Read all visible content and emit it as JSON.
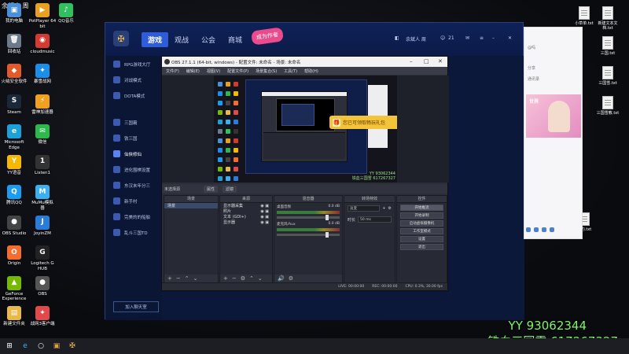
{
  "desktop": {
    "user_tag": "余额人 周",
    "icons": [
      {
        "label": "我的电脑",
        "glyph": "▣",
        "color": "#4a90d9"
      },
      {
        "label": "PotPlayer 64\nbit",
        "glyph": "▶",
        "color": "#e8a020"
      },
      {
        "label": "QQ音乐",
        "glyph": "♪",
        "color": "#30c060"
      },
      {
        "label": "回收站",
        "glyph": "🗑",
        "color": "#6c7a89"
      },
      {
        "label": "cloudmusic",
        "glyph": "◉",
        "color": "#d33a31"
      },
      {
        "label": "火绒安全软件",
        "glyph": "◆",
        "color": "#e05a2a"
      },
      {
        "label": "暴雪战网",
        "glyph": "✦",
        "color": "#1a8ee8"
      },
      {
        "label": "Steam",
        "glyph": "S",
        "color": "#1b2838"
      },
      {
        "label": "雷神加速器",
        "glyph": "⚡",
        "color": "#f0a020"
      },
      {
        "label": "Microsoft\nEdge",
        "glyph": "e",
        "color": "#1ba0d8"
      },
      {
        "label": "微信",
        "glyph": "✉",
        "color": "#2db84d"
      },
      {
        "label": "YY语音",
        "glyph": "Y",
        "color": "#f6b800"
      },
      {
        "label": "Listen1",
        "glyph": "1",
        "color": "#333"
      },
      {
        "label": "腾讯QQ",
        "glyph": "Q",
        "color": "#1a9cf0"
      },
      {
        "label": "MuMu模拟\n器",
        "glyph": "M",
        "color": "#3ab0f0"
      },
      {
        "label": "OBS Studio",
        "glyph": "●",
        "color": "#444"
      },
      {
        "label": "JoyinZM",
        "glyph": "J",
        "color": "#2b7bd8"
      },
      {
        "label": "Origin",
        "glyph": "O",
        "color": "#f56c2d"
      },
      {
        "label": "Logitech G\nHUB",
        "glyph": "G",
        "color": "#222"
      },
      {
        "label": "GeForce\nExperience",
        "glyph": "▲",
        "color": "#76b900"
      },
      {
        "label": "OBS",
        "glyph": "●",
        "color": "#555"
      },
      {
        "label": "新建文件夹",
        "glyph": "▤",
        "color": "#e8b84a"
      },
      {
        "label": "战网3客户端",
        "glyph": "✦",
        "color": "#e04a4a"
      }
    ],
    "files": [
      {
        "label": "小草单.txt"
      },
      {
        "label": "新建文本文\n档.txt"
      },
      {
        "label": "三国.txt"
      },
      {
        "label": "三国雪.txt"
      },
      {
        "label": "三国雪教.txt"
      },
      {
        "label": "我的.txt"
      }
    ]
  },
  "launcher": {
    "nav": [
      "游戏",
      "观战",
      "公会",
      "商城"
    ],
    "badge": "成为作者",
    "user": "余斌人 周",
    "count": "21",
    "side_items": [
      "RPG游戏大厅",
      "对战模式",
      "DOTA模式",
      "三国霸",
      "铁三国",
      "仙侠修仙",
      "进化围棋设置",
      "东汉末年分三",
      "新手村",
      "完美的的船舶",
      "乱斗三国TD"
    ],
    "join_button": "加入聊天室"
  },
  "chat": {
    "lines": [
      "@吗",
      "分享",
      "通讯录"
    ],
    "banner_text": "世界"
  },
  "obs": {
    "title": "OBS 27.1.1 (64-bit, windows) - 配置文件: 未命名 - 场景: 未命名",
    "menu": [
      "文件(F)",
      "编辑(E)",
      "视图(V)",
      "配置文件(P)",
      "场景集合(S)",
      "工具(T)",
      "帮助(H)"
    ],
    "preview": {
      "toast": "您已可领取畅玩礼包",
      "watermark_1": "YY 93062344",
      "watermark_2": "铁血三国雪 617267327"
    },
    "context_bar": {
      "label": "未选择源",
      "tab1": "属性",
      "tab2": "滤镜"
    },
    "docks": {
      "scenes": {
        "title": "场景",
        "rows": [
          "场景"
        ]
      },
      "sources": {
        "title": "来源",
        "rows": [
          "显示器采集",
          "照片",
          "文本 (GDI+)",
          "显示器"
        ]
      },
      "mixer": {
        "title": "混音器",
        "channels": [
          "桌面音频",
          "麦克风/Aux"
        ],
        "levels": [
          "0.0 dB",
          "0.0 dB"
        ]
      },
      "transitions": {
        "title": "转场特效",
        "type": "淡变",
        "duration_label": "时长",
        "duration": "50 ms"
      },
      "controls": {
        "title": "控件",
        "buttons": [
          "开始推流",
          "开始录制",
          "启动虚拟摄像机",
          "工作室模式",
          "设置",
          "退出"
        ]
      }
    },
    "status": [
      "LIVE: 00:00:00",
      "REC: 00:00:00",
      "CPU: 0.3%, 30.00 fps"
    ]
  },
  "watermark": {
    "line1": "YY 93062344",
    "line2": "铁血三国雪 617267327"
  },
  "colors": {
    "accent": "#2f5cd8",
    "watermark": "#7ff56a",
    "toast": "#f3c43a"
  }
}
